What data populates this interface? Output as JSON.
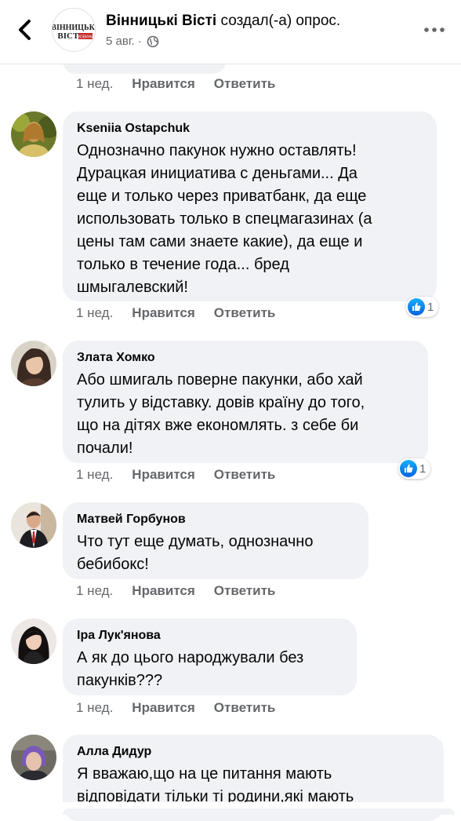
{
  "header": {
    "page_name": "Вінницькі Вісті",
    "action_text": " создал(-а) опрос.",
    "date": "5 авг. ·",
    "logo_top": "ВІННИЦЬКІ",
    "logo_bottom": "ВІСТІ",
    "logo_tag": "НОВИНИ",
    "back_icon": "back-arrow-icon",
    "privacy_icon": "globe-icon",
    "more_icon": "more-dots-icon"
  },
  "labels": {
    "like": "Нравится",
    "reply": "Ответить"
  },
  "top_time": "1 нед.",
  "comments": [
    {
      "author": "Kseniia Ostapchuk",
      "text": "Однозначно пакунок нужно оставлять!\nДурацкая инициатива с деньгами... Да\nеще и только через приватбанк, да еще\nиспользовать только в спецмагазинах (а\nцены там сами знаете какие), да еще и\nтолько в течение года... бред\nшмыгалевский!",
      "time": "1 нед.",
      "reactions": "1"
    },
    {
      "author": "Злата Хомко",
      "text": "Або шмигаль поверне пакунки, або хай\nтулить у відставку. довів країну до того,\nщо на дітях вже економлять. з себе би\nпочали!",
      "time": "1 нед.",
      "reactions": "1"
    },
    {
      "author": "Матвей Горбунов",
      "text": "Что тут еще думать, однозначно\nбебибокс!",
      "time": "1 нед."
    },
    {
      "author": "Іра Лук'янова",
      "text": "А як до цього народжували без\nпакунків???",
      "time": "1 нед."
    },
    {
      "author": "Алла Дидур",
      "text": "Я вважаю,що на це питання мають\nвідповідати тільки ті родини,які мають"
    }
  ],
  "colors": {
    "bubble": "#f0f2f5",
    "meta_text": "#65676b",
    "like_blue": "#1877f2"
  }
}
